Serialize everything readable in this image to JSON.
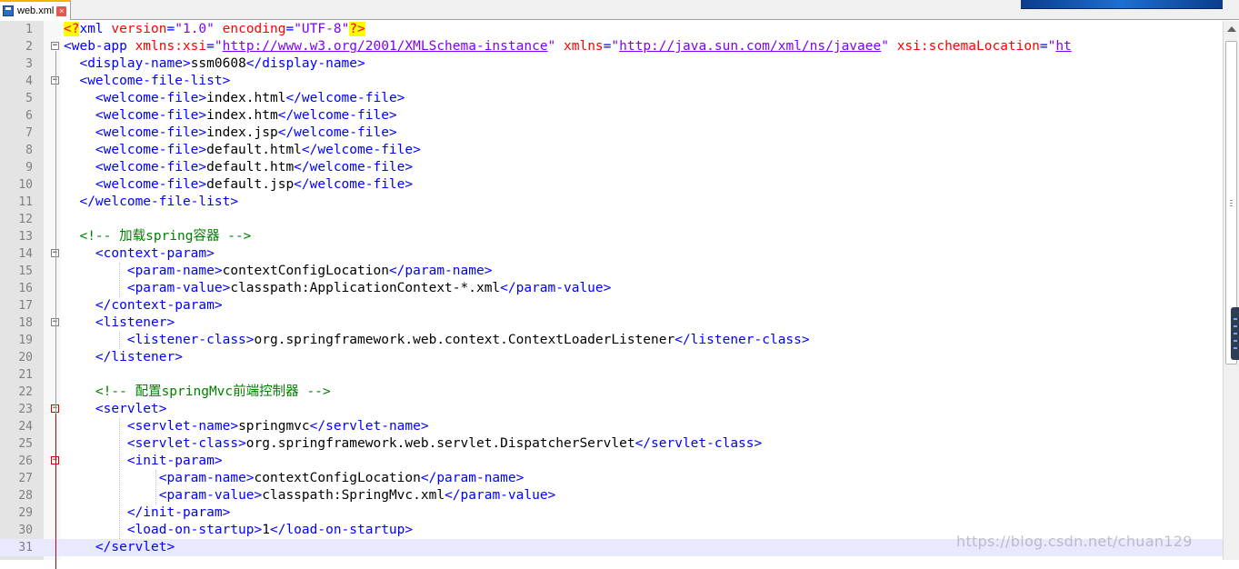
{
  "tab": {
    "title": "web.xml",
    "close_symbol": "×"
  },
  "colors": {
    "tag": "#0000ff",
    "text": "#000000",
    "attr": "#ff0000",
    "value": "#8000ff",
    "comment": "#008000",
    "pi_highlight": "#ffff00",
    "current_line": "#e8e8ff",
    "fold_error": "#d00000"
  },
  "icons": {
    "tab_icon": "save-disk-icon",
    "close": "close-icon",
    "scroll_up": "arrow-up-icon"
  },
  "watermark": "https://blog.csdn.net/chuan129",
  "lines": [
    {
      "n": "1",
      "segs": [
        [
          "pi",
          "<?"
        ],
        [
          "tag",
          "xml "
        ],
        [
          "attr",
          "version"
        ],
        [
          "tag",
          "="
        ],
        [
          "val",
          "\"1.0\""
        ],
        [
          "tag",
          " "
        ],
        [
          "attr",
          "encoding"
        ],
        [
          "tag",
          "="
        ],
        [
          "val",
          "\"UTF-8\""
        ],
        [
          "pi",
          "?>"
        ]
      ]
    },
    {
      "n": "2",
      "segs": [
        [
          "tag",
          "<web-app "
        ],
        [
          "attr",
          "xmlns:xsi"
        ],
        [
          "tag",
          "="
        ],
        [
          "val",
          "\""
        ],
        [
          "link",
          "http://www.w3.org/2001/XMLSchema-instance"
        ],
        [
          "val",
          "\""
        ],
        [
          "tag",
          " "
        ],
        [
          "attr",
          "xmlns"
        ],
        [
          "tag",
          "="
        ],
        [
          "val",
          "\""
        ],
        [
          "link",
          "http://java.sun.com/xml/ns/javaee"
        ],
        [
          "val",
          "\""
        ],
        [
          "tag",
          " "
        ],
        [
          "attr",
          "xsi:schemaLocation"
        ],
        [
          "tag",
          "="
        ],
        [
          "val",
          "\""
        ],
        [
          "link",
          "ht"
        ]
      ]
    },
    {
      "n": "3",
      "segs": [
        [
          "txt",
          "  "
        ],
        [
          "tag",
          "<display-name>"
        ],
        [
          "txt",
          "ssm0608"
        ],
        [
          "tag",
          "</display-name>"
        ]
      ]
    },
    {
      "n": "4",
      "segs": [
        [
          "txt",
          "  "
        ],
        [
          "tag",
          "<welcome-file-list>"
        ]
      ]
    },
    {
      "n": "5",
      "segs": [
        [
          "txt",
          "    "
        ],
        [
          "tag",
          "<welcome-file>"
        ],
        [
          "txt",
          "index.html"
        ],
        [
          "tag",
          "</welcome-file>"
        ]
      ]
    },
    {
      "n": "6",
      "segs": [
        [
          "txt",
          "    "
        ],
        [
          "tag",
          "<welcome-file>"
        ],
        [
          "txt",
          "index.htm"
        ],
        [
          "tag",
          "</welcome-file>"
        ]
      ]
    },
    {
      "n": "7",
      "segs": [
        [
          "txt",
          "    "
        ],
        [
          "tag",
          "<welcome-file>"
        ],
        [
          "txt",
          "index.jsp"
        ],
        [
          "tag",
          "</welcome-file>"
        ]
      ]
    },
    {
      "n": "8",
      "segs": [
        [
          "txt",
          "    "
        ],
        [
          "tag",
          "<welcome-file>"
        ],
        [
          "txt",
          "default.html"
        ],
        [
          "tag",
          "</welcome-file>"
        ]
      ]
    },
    {
      "n": "9",
      "segs": [
        [
          "txt",
          "    "
        ],
        [
          "tag",
          "<welcome-file>"
        ],
        [
          "txt",
          "default.htm"
        ],
        [
          "tag",
          "</welcome-file>"
        ]
      ]
    },
    {
      "n": "10",
      "segs": [
        [
          "txt",
          "    "
        ],
        [
          "tag",
          "<welcome-file>"
        ],
        [
          "txt",
          "default.jsp"
        ],
        [
          "tag",
          "</welcome-file>"
        ]
      ]
    },
    {
      "n": "11",
      "segs": [
        [
          "txt",
          "  "
        ],
        [
          "tag",
          "</welcome-file-list>"
        ]
      ]
    },
    {
      "n": "12",
      "segs": []
    },
    {
      "n": "13",
      "segs": [
        [
          "txt",
          "  "
        ],
        [
          "cmt",
          "<!-- 加载spring容器 -->"
        ]
      ]
    },
    {
      "n": "14",
      "segs": [
        [
          "txt",
          "    "
        ],
        [
          "tag",
          "<context-param>"
        ]
      ]
    },
    {
      "n": "15",
      "segs": [
        [
          "txt",
          "        "
        ],
        [
          "tag",
          "<param-name>"
        ],
        [
          "txt",
          "contextConfigLocation"
        ],
        [
          "tag",
          "</param-name>"
        ]
      ]
    },
    {
      "n": "16",
      "segs": [
        [
          "txt",
          "        "
        ],
        [
          "tag",
          "<param-value>"
        ],
        [
          "txt",
          "classpath:ApplicationContext-*.xml"
        ],
        [
          "tag",
          "</param-value>"
        ]
      ]
    },
    {
      "n": "17",
      "segs": [
        [
          "txt",
          "    "
        ],
        [
          "tag",
          "</context-param>"
        ]
      ]
    },
    {
      "n": "18",
      "segs": [
        [
          "txt",
          "    "
        ],
        [
          "tag",
          "<listener>"
        ]
      ]
    },
    {
      "n": "19",
      "segs": [
        [
          "txt",
          "        "
        ],
        [
          "tag",
          "<listener-class>"
        ],
        [
          "txt",
          "org.springframework.web.context.ContextLoaderListener"
        ],
        [
          "tag",
          "</listener-class>"
        ]
      ]
    },
    {
      "n": "20",
      "segs": [
        [
          "txt",
          "    "
        ],
        [
          "tag",
          "</listener>"
        ]
      ]
    },
    {
      "n": "21",
      "segs": []
    },
    {
      "n": "22",
      "segs": [
        [
          "txt",
          "    "
        ],
        [
          "cmt",
          "<!-- 配置springMvc前端控制器 -->"
        ]
      ]
    },
    {
      "n": "23",
      "segs": [
        [
          "txt",
          "    "
        ],
        [
          "tag",
          "<servlet>"
        ]
      ]
    },
    {
      "n": "24",
      "segs": [
        [
          "txt",
          "        "
        ],
        [
          "tag",
          "<servlet-name>"
        ],
        [
          "txt",
          "springmvc"
        ],
        [
          "tag",
          "</servlet-name>"
        ]
      ]
    },
    {
      "n": "25",
      "segs": [
        [
          "txt",
          "        "
        ],
        [
          "tag",
          "<servlet-class>"
        ],
        [
          "txt",
          "org.springframework.web.servlet.DispatcherServlet"
        ],
        [
          "tag",
          "</servlet-class>"
        ]
      ]
    },
    {
      "n": "26",
      "segs": [
        [
          "txt",
          "        "
        ],
        [
          "tag",
          "<init-param>"
        ]
      ]
    },
    {
      "n": "27",
      "segs": [
        [
          "txt",
          "            "
        ],
        [
          "tag",
          "<param-name>"
        ],
        [
          "txt",
          "contextConfigLocation"
        ],
        [
          "tag",
          "</param-name>"
        ]
      ]
    },
    {
      "n": "28",
      "segs": [
        [
          "txt",
          "            "
        ],
        [
          "tag",
          "<param-value>"
        ],
        [
          "txt",
          "classpath:SpringMvc.xml"
        ],
        [
          "tag",
          "</param-value>"
        ]
      ]
    },
    {
      "n": "29",
      "segs": [
        [
          "txt",
          "        "
        ],
        [
          "tag",
          "</init-param>"
        ]
      ]
    },
    {
      "n": "30",
      "segs": [
        [
          "txt",
          "        "
        ],
        [
          "tag",
          "<load-on-startup>"
        ],
        [
          "txt",
          "1"
        ],
        [
          "tag",
          "</load-on-startup>"
        ]
      ]
    },
    {
      "n": "31",
      "segs": [
        [
          "txt",
          "    "
        ],
        [
          "tag",
          "</servlet>"
        ]
      ]
    }
  ],
  "current_line": "31",
  "fold_open_lines": [
    "2",
    "4",
    "14",
    "18"
  ],
  "fold_open_error_lines": [
    "23",
    "26"
  ],
  "fold_end_lines": [
    "11",
    "17",
    "20"
  ],
  "fold_end_error_lines": [
    "29",
    "31"
  ]
}
